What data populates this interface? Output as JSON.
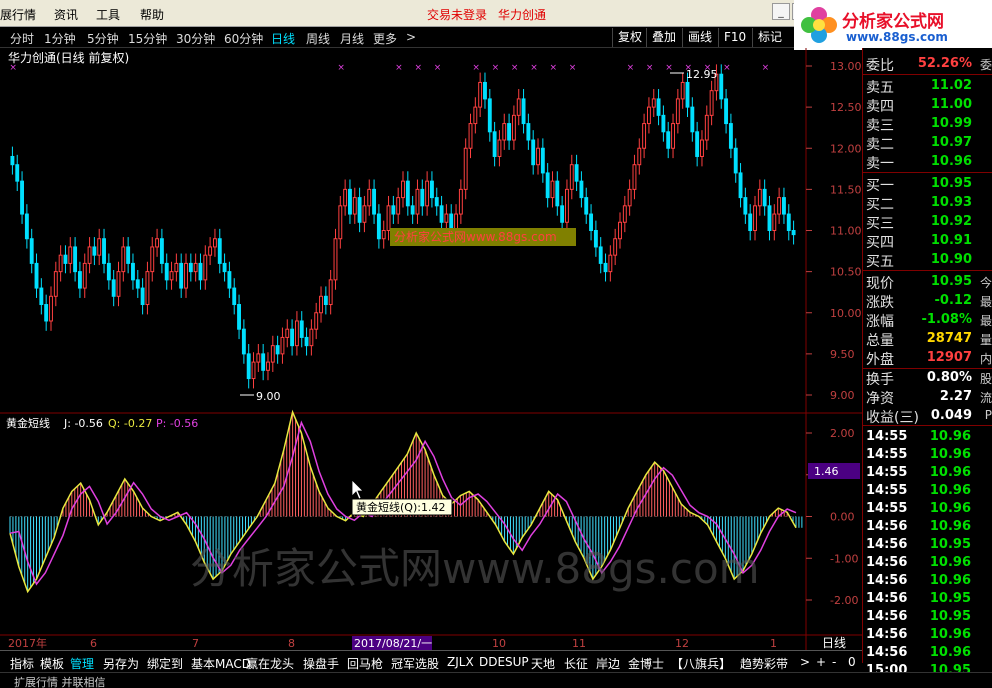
{
  "menu": {
    "items": [
      "展行情",
      "资讯",
      "工具",
      "帮助"
    ],
    "login_notice": "交易未登录",
    "stock_name": "华力创通"
  },
  "logo": {
    "title": "分析家公式网",
    "url": "www.88gs.com"
  },
  "periods": {
    "items": [
      "分时",
      "1分钟",
      "5分钟",
      "15分钟",
      "30分钟",
      "60分钟",
      "日线",
      "周线",
      "月线",
      "更多"
    ],
    "active": "日线",
    "more_arrow": ">"
  },
  "toolbar": {
    "buttons": [
      "复权",
      "叠加",
      "画线",
      "F10",
      "标记"
    ]
  },
  "chart": {
    "title": "华力创通(日线 前复权)",
    "high_label": "12.95",
    "low_label": "9.00",
    "watermark_small": "分析家公式网www.88gs.com",
    "watermark_big": "分析家公式网www.88gs.com",
    "price_axis": [
      "13.00",
      "12.50",
      "12.00",
      "11.50",
      "11.00",
      "10.50",
      "10.00",
      "9.50",
      "9.00"
    ],
    "indicator_title": "黄金短线",
    "indicator_j": "J: -0.56",
    "indicator_q": "Q: -0.27",
    "indicator_p": "P: -0.56",
    "tooltip": "黄金短线(Q):1.42",
    "cursor_value": "1.46",
    "indicator_axis": [
      "2.00",
      "1.00",
      "0.00",
      "-1.00",
      "-2.00"
    ],
    "date_labels": [
      "2017年",
      "6",
      "7",
      "8",
      "2017/08/21/一",
      "10",
      "11",
      "12",
      "1"
    ],
    "period_label": "日线"
  },
  "chart_data": {
    "type": "candlestick",
    "price_ylim": [
      9.0,
      13.0
    ],
    "indicator_ylim": [
      -2.0,
      2.0
    ],
    "closes": [
      11.8,
      11.6,
      11.2,
      10.9,
      10.6,
      10.3,
      10.1,
      9.9,
      10.2,
      10.5,
      10.7,
      10.6,
      10.8,
      10.5,
      10.3,
      10.6,
      10.8,
      10.7,
      10.9,
      10.6,
      10.4,
      10.2,
      10.5,
      10.8,
      10.6,
      10.4,
      10.3,
      10.1,
      10.5,
      10.8,
      10.9,
      10.6,
      10.4,
      10.5,
      10.6,
      10.3,
      10.6,
      10.5,
      10.6,
      10.4,
      10.7,
      10.8,
      10.9,
      10.6,
      10.5,
      10.3,
      10.1,
      9.8,
      9.5,
      9.2,
      9.4,
      9.5,
      9.3,
      9.4,
      9.6,
      9.5,
      9.7,
      9.8,
      9.6,
      9.9,
      9.7,
      9.6,
      9.8,
      10.0,
      10.2,
      10.1,
      10.4,
      10.9,
      11.3,
      11.5,
      11.2,
      11.4,
      11.1,
      11.3,
      11.5,
      11.2,
      10.9,
      11.0,
      11.3,
      11.2,
      11.4,
      11.6,
      11.3,
      11.2,
      11.5,
      11.3,
      11.6,
      11.4,
      11.3,
      11.1,
      11.2,
      11.0,
      11.2,
      11.5,
      12.0,
      12.3,
      12.5,
      12.8,
      12.6,
      12.2,
      11.9,
      12.1,
      12.3,
      12.1,
      12.4,
      12.6,
      12.3,
      12.1,
      11.8,
      12.0,
      11.7,
      11.4,
      11.6,
      11.3,
      11.1,
      11.5,
      11.8,
      11.6,
      11.4,
      11.2,
      11.0,
      10.8,
      10.6,
      10.5,
      10.7,
      10.9,
      11.1,
      11.3,
      11.5,
      11.8,
      12.0,
      12.3,
      12.5,
      12.6,
      12.4,
      12.2,
      12.0,
      12.3,
      12.6,
      12.8,
      12.5,
      12.2,
      11.9,
      12.1,
      12.4,
      12.7,
      12.9,
      12.6,
      12.3,
      12.0,
      11.7,
      11.4,
      11.2,
      11.0,
      11.3,
      11.5,
      11.3,
      11.0,
      11.2,
      11.4,
      11.2,
      11.0,
      10.95
    ],
    "indicator_q": [
      -0.4,
      -1.2,
      -1.8,
      -1.5,
      -1.0,
      -0.5,
      0.2,
      0.6,
      0.8,
      0.4,
      -0.2,
      0.1,
      0.5,
      0.9,
      0.6,
      0.2,
      0.0,
      -0.1,
      0.0,
      0.1,
      -0.2,
      -0.6,
      -1.1,
      -1.5,
      -1.3,
      -0.9,
      -0.6,
      -0.3,
      0.0,
      0.4,
      0.8,
      1.6,
      2.5,
      2.0,
      1.2,
      0.6,
      0.2,
      0.0,
      -0.1,
      0.1,
      0.0,
      0.3,
      0.6,
      0.9,
      1.2,
      1.5,
      2.0,
      1.6,
      1.0,
      0.5,
      0.3,
      0.5,
      0.6,
      0.4,
      0.1,
      -0.2,
      -0.6,
      -0.9,
      -0.5,
      -0.2,
      0.2,
      0.6,
      0.4,
      -0.1,
      -0.6,
      -1.0,
      -1.5,
      -1.2,
      -0.8,
      -0.3,
      0.2,
      0.6,
      1.0,
      1.3,
      1.1,
      0.7,
      0.3,
      0.1,
      0.0,
      -0.2,
      -0.6,
      -1.0,
      -1.5,
      -1.3,
      -0.9,
      -0.4,
      0.0,
      0.2,
      0.1,
      -0.27
    ],
    "indicator_j_last": -0.56,
    "indicator_q_last": -0.27,
    "indicator_p_last": -0.56
  },
  "quote": {
    "ratio": {
      "label": "委比",
      "value": "52.26%",
      "suffix": "委"
    },
    "sells": [
      {
        "label": "卖五",
        "value": "11.02"
      },
      {
        "label": "卖四",
        "value": "11.00"
      },
      {
        "label": "卖三",
        "value": "10.99"
      },
      {
        "label": "卖二",
        "value": "10.97"
      },
      {
        "label": "卖一",
        "value": "10.96"
      }
    ],
    "buys": [
      {
        "label": "买一",
        "value": "10.95"
      },
      {
        "label": "买二",
        "value": "10.93"
      },
      {
        "label": "买三",
        "value": "10.92"
      },
      {
        "label": "买四",
        "value": "10.91"
      },
      {
        "label": "买五",
        "value": "10.90"
      }
    ],
    "stats": [
      {
        "label": "现价",
        "value": "10.95",
        "color": "#00e000",
        "suffix": "今"
      },
      {
        "label": "涨跌",
        "value": "-0.12",
        "color": "#00e000",
        "suffix": "最"
      },
      {
        "label": "涨幅",
        "value": "-1.08%",
        "color": "#00e000",
        "suffix": "最"
      },
      {
        "label": "总量",
        "value": "28747",
        "color": "#ffd700",
        "suffix": "量"
      },
      {
        "label": "外盘",
        "value": "12907",
        "color": "#ff4040",
        "suffix": "内"
      }
    ],
    "extra": [
      {
        "label": "换手",
        "value": "0.80%",
        "suffix": "股"
      },
      {
        "label": "净资",
        "value": "2.27",
        "suffix": "流"
      },
      {
        "label": "收益(三)",
        "value": "0.049",
        "suffix": "P"
      }
    ],
    "ticks": [
      {
        "time": "14:55",
        "price": "10.96"
      },
      {
        "time": "14:55",
        "price": "10.96"
      },
      {
        "time": "14:55",
        "price": "10.96"
      },
      {
        "time": "14:55",
        "price": "10.96"
      },
      {
        "time": "14:55",
        "price": "10.96"
      },
      {
        "time": "14:56",
        "price": "10.96"
      },
      {
        "time": "14:56",
        "price": "10.95"
      },
      {
        "time": "14:56",
        "price": "10.96"
      },
      {
        "time": "14:56",
        "price": "10.96"
      },
      {
        "time": "14:56",
        "price": "10.95"
      },
      {
        "time": "14:56",
        "price": "10.95"
      },
      {
        "time": "14:56",
        "price": "10.96"
      },
      {
        "time": "14:56",
        "price": "10.96"
      },
      {
        "time": "15:00",
        "price": "10.95"
      }
    ]
  },
  "tabs": {
    "items": [
      "指标",
      "模板",
      "管理",
      "另存为",
      "绑定到",
      "基本MACD",
      "赢在龙头",
      "操盘手",
      "回马枪",
      "冠军选股",
      "ZJLX",
      "DDE",
      "SUP",
      "天地",
      "长征",
      "岸边",
      "金博士",
      "【八旗兵】",
      "趋势彩带"
    ],
    "active": "管理",
    "arrow": ">",
    "plus": "+",
    "minus": "-",
    "zero": "0"
  },
  "status": {
    "text": "扩展行情 并联相信"
  }
}
